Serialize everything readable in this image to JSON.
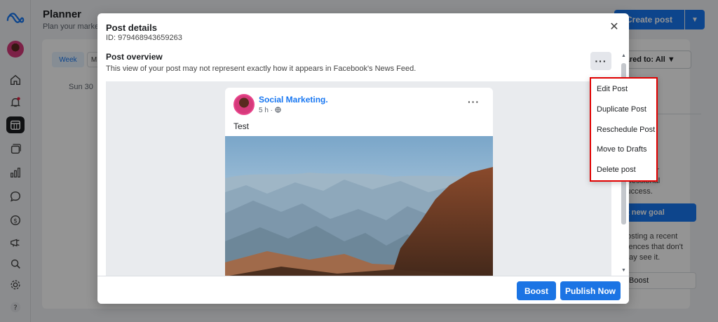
{
  "background": {
    "planner_title": "Planner",
    "planner_subtitle": "Plan your market",
    "create_post_label": "Create post",
    "week_tab": "Week",
    "month_tab_partial": "M",
    "day_label": "Sun 30",
    "shared_filter": "hared to: All",
    "right_text_1": [
      "al, track",
      "and learn",
      "ps for your",
      "rofessional",
      "success."
    ],
    "goal_button": "t new goal",
    "right_text_2": [
      "oosting a recent",
      "diences that don't",
      "may see it."
    ],
    "boost_button": "Boost"
  },
  "modal": {
    "title": "Post details",
    "post_id": "ID: 979468943659263",
    "overview_title": "Post overview",
    "overview_subtitle": "This view of your post may not represent exactly how it appears in Facebook's News Feed.",
    "more_label": "···",
    "close_label": "✕"
  },
  "post": {
    "page_name": "Social Marketing.",
    "time": "5 h ·",
    "text": "Test",
    "more_label": "···"
  },
  "footer": {
    "boost_label": "Boost",
    "publish_label": "Publish Now"
  },
  "dropdown": {
    "items": [
      "Edit Post",
      "Duplicate Post",
      "Reschedule Post",
      "Move to Drafts",
      "Delete post"
    ]
  },
  "rail": {
    "icons": [
      "meta-logo-icon",
      "profile-avatar-icon",
      "home-icon",
      "notifications-icon",
      "planner-icon",
      "content-icon",
      "insights-icon",
      "inbox-icon",
      "monetization-icon",
      "ads-icon",
      "search-icon",
      "settings-icon",
      "help-icon"
    ]
  },
  "colors": {
    "primary": "#1b74e4",
    "highlight": "#e00000",
    "overlay": "rgba(0,0,0,0.42)"
  }
}
